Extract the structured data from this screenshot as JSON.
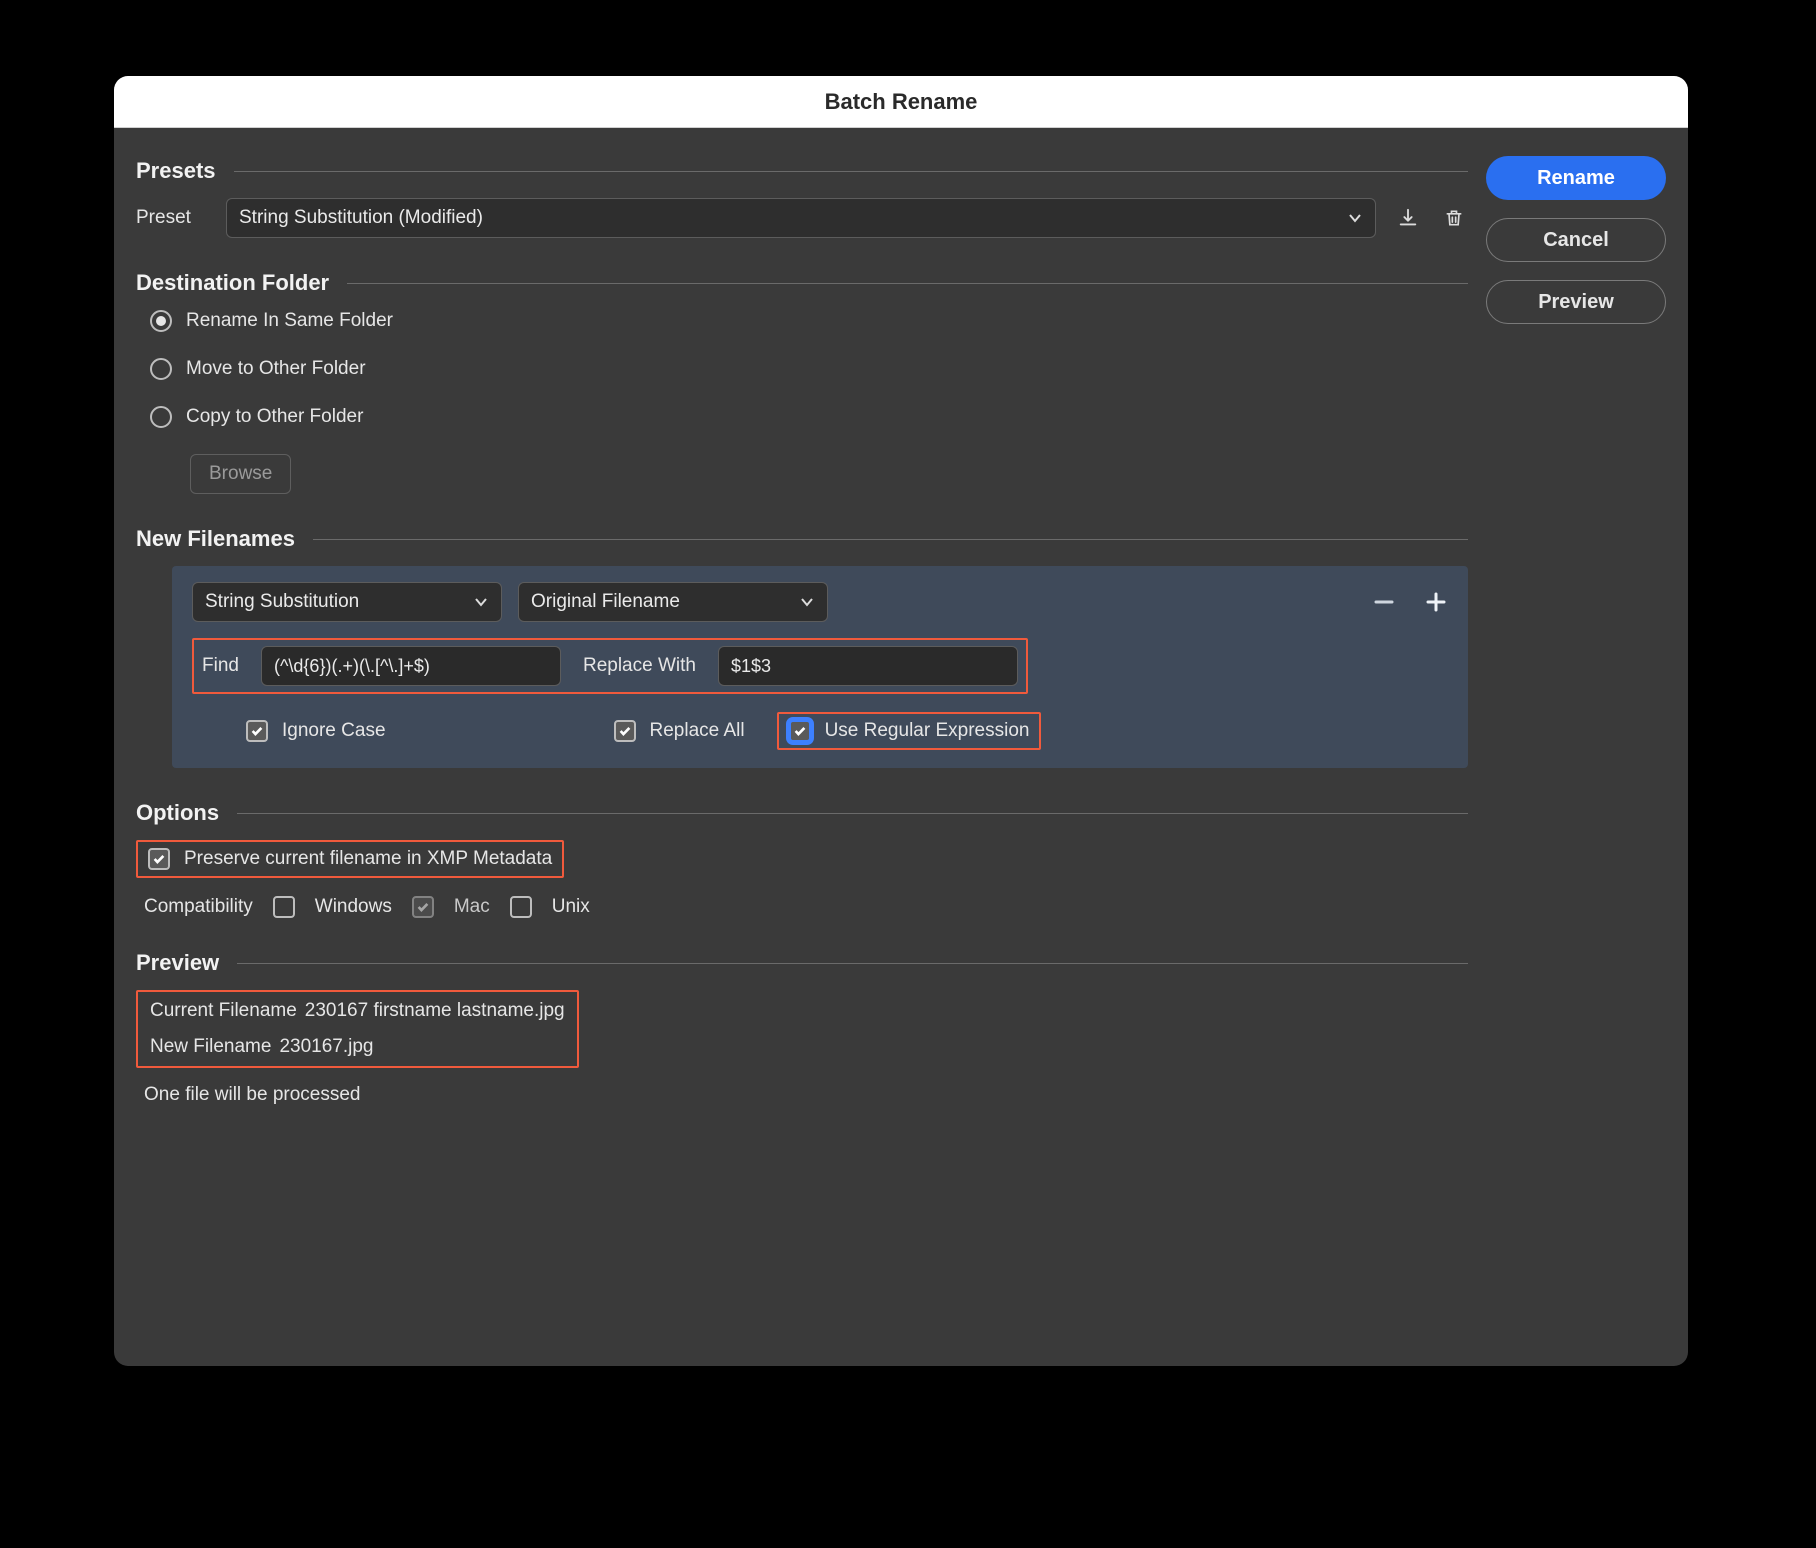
{
  "title": "Batch Rename",
  "buttons": {
    "rename": "Rename",
    "cancel": "Cancel",
    "preview": "Preview"
  },
  "presets": {
    "section": "Presets",
    "label": "Preset",
    "value": "String Substitution (Modified)"
  },
  "destination": {
    "section": "Destination Folder",
    "options": [
      {
        "label": "Rename In Same Folder",
        "checked": true
      },
      {
        "label": "Move to Other Folder",
        "checked": false
      },
      {
        "label": "Copy to Other Folder",
        "checked": false
      }
    ],
    "browse": "Browse"
  },
  "new_filenames": {
    "section": "New Filenames",
    "type_value": "String Substitution",
    "source_value": "Original Filename",
    "find_label": "Find",
    "find_value": "(^\\d{6})(.+)(\\.[^\\.]+$)",
    "replace_label": "Replace With",
    "replace_value": "$1$3",
    "ignore_case": {
      "label": "Ignore Case",
      "checked": true
    },
    "replace_all": {
      "label": "Replace All",
      "checked": true
    },
    "use_regex": {
      "label": "Use Regular Expression",
      "checked": true
    }
  },
  "options": {
    "section": "Options",
    "preserve_xmp": {
      "label": "Preserve current filename in XMP Metadata",
      "checked": true
    },
    "compat_label": "Compatibility",
    "windows": {
      "label": "Windows",
      "checked": false
    },
    "mac": {
      "label": "Mac",
      "checked": true,
      "disabled": true
    },
    "unix": {
      "label": "Unix",
      "checked": false
    }
  },
  "preview": {
    "section": "Preview",
    "current_label": "Current Filename",
    "current_value": "230167 firstname lastname.jpg",
    "new_label": "New Filename",
    "new_value": "230167.jpg",
    "status": "One file will be processed"
  }
}
